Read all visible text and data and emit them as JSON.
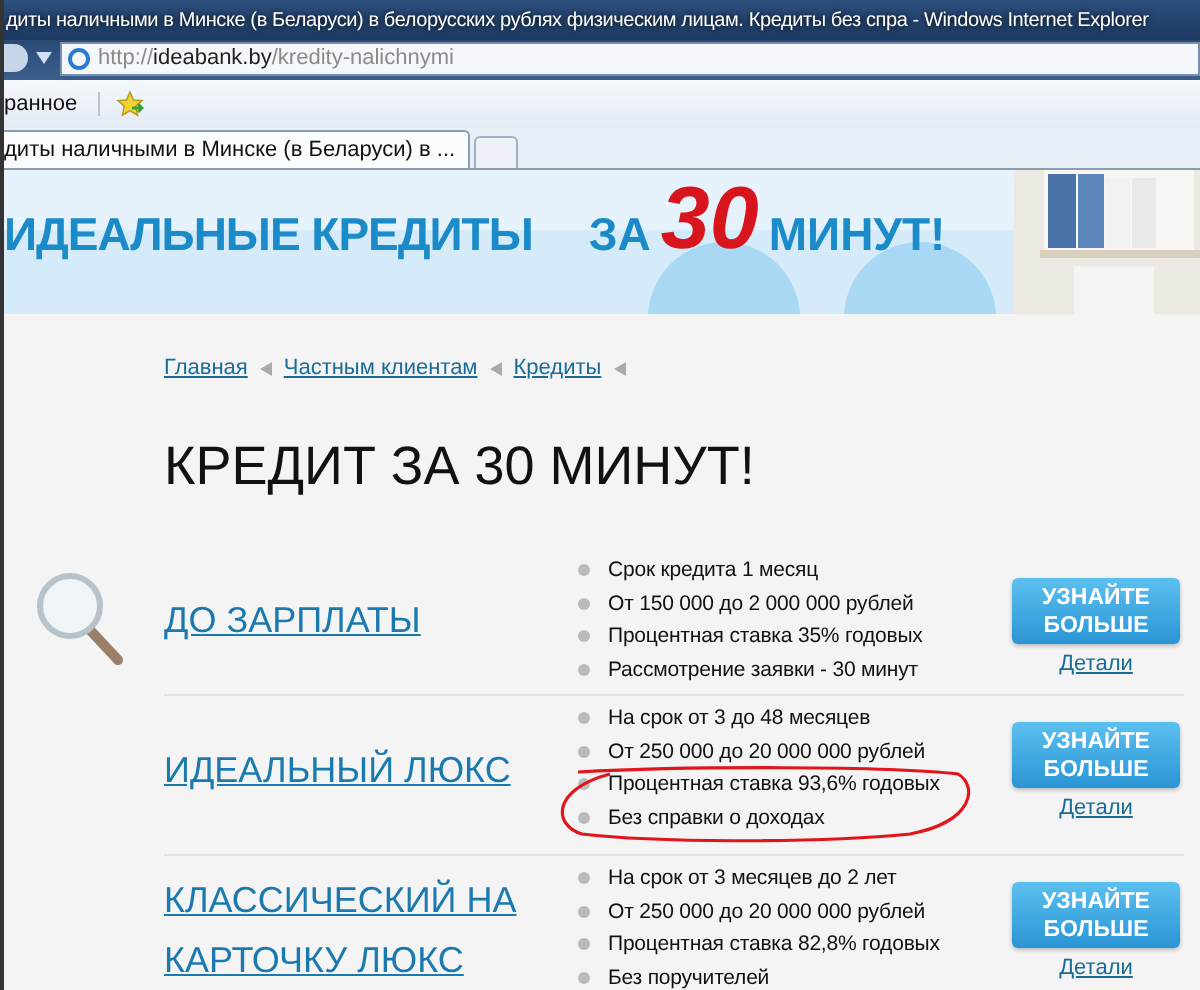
{
  "window": {
    "title": "диты наличными в Минске (в Беларуси) в белорусских рублях физическим лицам. Кредиты без спра - Windows Internet Explorer"
  },
  "address": {
    "scheme": "http://",
    "host": "ideabank.by",
    "path": "/kredity-nalichnymi"
  },
  "favorites": {
    "label": "ранное"
  },
  "tabs": [
    {
      "label": "диты наличными в Минске (в Беларуси) в ...",
      "selected": true
    }
  ],
  "banner": {
    "headline": "ИДЕАЛЬНЫЕ КРЕДИТЫ",
    "slogan_start": "ЗА",
    "slogan_number": "30",
    "slogan_end": "МИНУТ!"
  },
  "breadcrumbs": [
    "Главная",
    "Частным клиентам",
    "Кредиты"
  ],
  "heading": "КРЕДИТ ЗА 30 МИНУТ!",
  "products": [
    {
      "title": "ДО ЗАРПЛАТЫ",
      "icon": true,
      "features": [
        {
          "text": "Срок кредита 1 месяц",
          "highlighted": false
        },
        {
          "text": "От 150 000 до 2 000 000 рублей",
          "highlighted": false
        },
        {
          "text": "Процентная ставка 35% годовых",
          "highlighted": false
        },
        {
          "text": "Рассмотрение заявки - 30 минут",
          "highlighted": false
        }
      ],
      "button": "УЗНАЙТЕ БОЛЬШЕ",
      "details": "Детали"
    },
    {
      "title": "ИДЕАЛЬНЫЙ ЛЮКС",
      "icon": false,
      "features": [
        {
          "text": "На срок от 3 до 48 месяцев",
          "highlighted": false
        },
        {
          "text": "От 250 000 до 20 000 000 рублей",
          "highlighted": false
        },
        {
          "text": "Процентная ставка 93,6% годовых",
          "highlighted": true
        },
        {
          "text": "Без справки о доходах",
          "highlighted": true
        }
      ],
      "button": "УЗНАЙТЕ БОЛЬШЕ",
      "details": "Детали"
    },
    {
      "title": "КЛАССИЧЕСКИЙ НА КАРТОЧКУ ЛЮКС",
      "icon": false,
      "features": [
        {
          "text": "На срок от 3 месяцев до 2 лет",
          "highlighted": false
        },
        {
          "text": "От 250 000 до 20 000 000 рублей",
          "highlighted": false
        },
        {
          "text": "Процентная ставка 82,8% годовых",
          "highlighted": false
        },
        {
          "text": "Без поручителей",
          "highlighted": false
        }
      ],
      "button": "УЗНАЙТЕ БОЛЬШЕ",
      "details": "Детали"
    }
  ]
}
